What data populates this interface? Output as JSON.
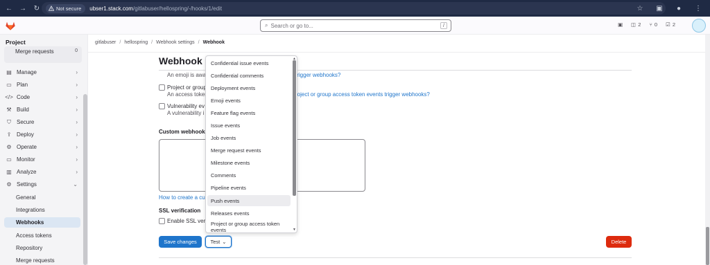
{
  "browser": {
    "not_secure": "Not secure",
    "url_host": "ubser1.stack.com",
    "url_path": "/gitlabuser/hellospring/-/hooks/1/edit"
  },
  "topbar": {
    "search_placeholder": "Search or go to...",
    "search_shortcut": "/",
    "issues_count": "2",
    "mr_count": "0",
    "todos_count": "2"
  },
  "sidebar": {
    "project_label": "Project",
    "merge_requests_top": {
      "label": "Merge requests",
      "count": "0"
    },
    "sections": [
      {
        "label": "Manage",
        "icon": "manage-icon"
      },
      {
        "label": "Plan",
        "icon": "plan-icon"
      },
      {
        "label": "Code",
        "icon": "code-icon"
      },
      {
        "label": "Build",
        "icon": "build-icon"
      },
      {
        "label": "Secure",
        "icon": "shield-icon"
      },
      {
        "label": "Deploy",
        "icon": "deploy-icon"
      },
      {
        "label": "Operate",
        "icon": "operate-icon"
      },
      {
        "label": "Monitor",
        "icon": "monitor-icon"
      },
      {
        "label": "Analyze",
        "icon": "analyze-icon"
      },
      {
        "label": "Settings",
        "icon": "settings-icon"
      }
    ],
    "settings_children": [
      "General",
      "Integrations",
      "Webhooks",
      "Access tokens",
      "Repository",
      "Merge requests"
    ]
  },
  "breadcrumb": [
    "gitlabuser",
    "hellospring",
    "Webhook settings",
    "Webhook"
  ],
  "page": {
    "title": "Webhook",
    "emoji_desc": "An emoji is awa",
    "emoji_link": "trigger webhooks?",
    "project_token_label": "Project or group",
    "project_token_desc": "An access toker",
    "project_token_link": "roject or group access token events trigger webhooks?",
    "vuln_label": "Vulnerability ev",
    "vuln_desc": "A vulnerability i",
    "custom_template_label": "Custom webhook t",
    "how_to_link": "How to create a cu",
    "ssl_label": "SSL verification",
    "ssl_checkbox": "Enable SSL veri",
    "save_button": "Save changes",
    "test_button": "Test",
    "delete_button": "Delete"
  },
  "dropdown": {
    "items": [
      "Confidential issue events",
      "Confidential comments",
      "Deployment events",
      "Emoji events",
      "Feature flag events",
      "Issue events",
      "Job events",
      "Merge request events",
      "Milestone events",
      "Comments",
      "Pipeline events",
      "Push events",
      "Releases events",
      "Project or group access token events"
    ],
    "hovered": "Push events"
  },
  "colors": {
    "primary": "#1f75cb",
    "danger": "#dd2b0e",
    "browser_bg": "#1f2a44"
  }
}
